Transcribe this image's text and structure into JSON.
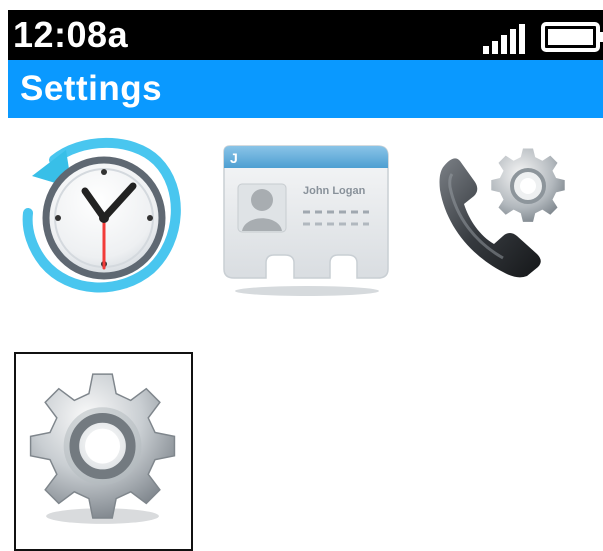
{
  "status": {
    "time": "12:08a",
    "signal_icon": "signal-strength-icon",
    "battery_icon": "battery-icon"
  },
  "header": {
    "title": "Settings"
  },
  "apps": [
    {
      "icon": "history-clock-icon",
      "selected": false
    },
    {
      "icon": "contact-card-icon",
      "card_name": "John Logan",
      "selected": false
    },
    {
      "icon": "phone-gear-icon",
      "selected": false
    },
    {
      "icon": "gear-icon",
      "selected": true
    }
  ],
  "colors": {
    "title_bar": "#0a99ff",
    "status_bar": "#000000",
    "accent_cyan": "#45c8f0"
  }
}
